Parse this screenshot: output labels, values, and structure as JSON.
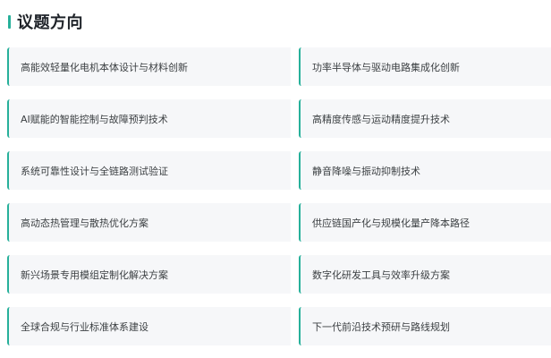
{
  "section": {
    "title": "议题方向",
    "accent_color": "#27b09a"
  },
  "topics": [
    "高能效轻量化电机本体设计与材料创新",
    "功率半导体与驱动电路集成化创新",
    "AI赋能的智能控制与故障预判技术",
    "高精度传感与运动精度提升技术",
    "系统可靠性设计与全链路测试验证",
    "静音降噪与振动抑制技术",
    "高动态热管理与散热优化方案",
    "供应链国产化与规模化量产降本路径",
    "新兴场景专用模组定制化解决方案",
    "数字化研发工具与效率升级方案",
    "全球合规与行业标准体系建设",
    "下一代前沿技术预研与路线规划"
  ]
}
